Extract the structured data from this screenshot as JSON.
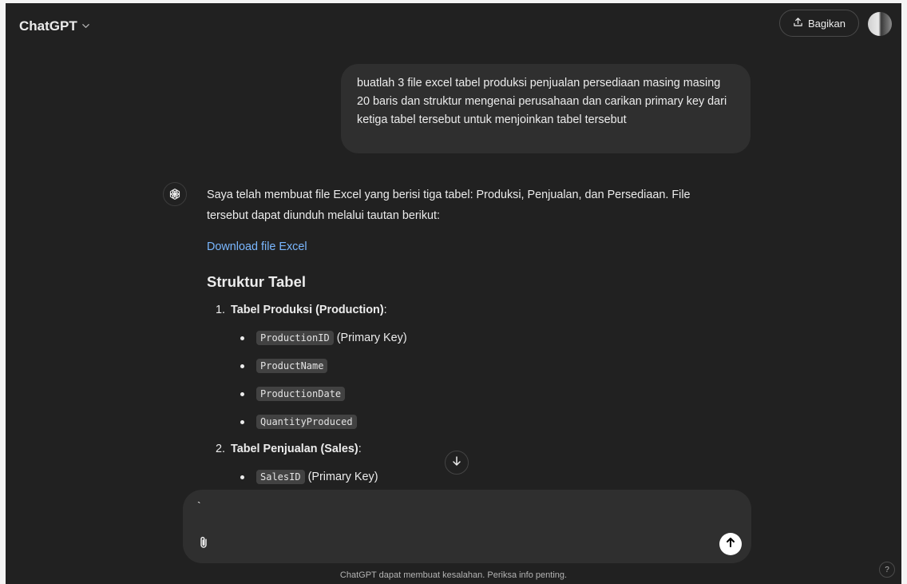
{
  "header": {
    "model_name": "ChatGPT",
    "share_label": "Bagikan"
  },
  "user_message": "buatlah 3 file excel tabel produksi penjualan persediaan masing masing 20 baris dan struktur mengenai perusahaan dan carikan primary key dari ketiga tabel tersebut untuk menjoinkan tabel tersebut",
  "assistant": {
    "intro": "Saya telah membuat file Excel yang berisi tiga tabel: Produksi, Penjualan, dan Persediaan. File tersebut dapat diunduh melalui tautan berikut:",
    "download_link": "Download file Excel",
    "section_heading": "Struktur Tabel",
    "tables": [
      {
        "number": "1.",
        "title": "Tabel Produksi (Production)",
        "suffix": ":",
        "fields": [
          {
            "code": "ProductionID",
            "note": "(Primary Key)"
          },
          {
            "code": "ProductName",
            "note": ""
          },
          {
            "code": "ProductionDate",
            "note": ""
          },
          {
            "code": "QuantityProduced",
            "note": ""
          }
        ]
      },
      {
        "number": "2.",
        "title": "Tabel Penjualan (Sales)",
        "suffix": ":",
        "fields": [
          {
            "code": "SalesID",
            "note": "(Primary Key)"
          }
        ]
      }
    ]
  },
  "composer": {
    "input_value": "`"
  },
  "footer": {
    "disclaimer": "ChatGPT dapat membuat kesalahan. Periksa info penting.",
    "help_label": "?"
  }
}
